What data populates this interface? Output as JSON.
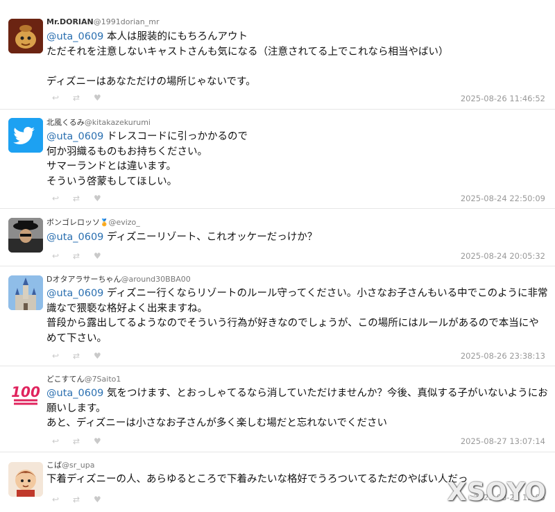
{
  "colors": {
    "mention": "#2a6fb0",
    "time": "#999999",
    "divider": "#e6e6e6"
  },
  "tweets": [
    {
      "name": "Mr.DORIAN",
      "handle": "@1991dorian_mr",
      "mention": "@uta_0609",
      "text": " 本人は服装的にもちろんアウト\nただそれを注意しないキャストさんも気になる（注意されてる上でこれなら相当やばい）\n\nディズニーはあなただけの場所じゃないです。",
      "time": "2025-08-26 11:46:52",
      "avatar_icon": "mrs-potts-icon"
    },
    {
      "name": "北風くるみ",
      "handle": "@kitakazekurumi",
      "mention": "@uta_0609",
      "text": " ドレスコードに引っかかるので\n何か羽織るものもお持ちください。\nサマーランドとは違います。\nそういう啓蒙もしてほしい。",
      "time": "2025-08-24 22:50:09",
      "avatar_icon": "twitter-bird-icon"
    },
    {
      "name": "ボンゴレロッソ",
      "badge": "🏅",
      "handle": "@evizo_",
      "mention": "@uta_0609",
      "text": " ディズニーリゾート、これオッケーだっけか？",
      "time": "2025-08-24 20:05:32",
      "avatar_icon": "person-hat-icon"
    },
    {
      "name": "Dオタアラサーちゃん",
      "handle": "@around30BBA00",
      "mention": "@uta_0609",
      "text": " ディズニー行くならリゾートのルール守ってください。小さなお子さんもいる中でこのように非常識なで猥褻な格好よく出来ますね。\n普段から露出してるようなのでそういう行為が好きなのでしょうが、この場所にはルールがあるので本当にやめて下さい。",
      "time": "2025-08-26 23:38:13",
      "avatar_icon": "castle-icon"
    },
    {
      "name": "どこすてん",
      "handle": "@7Saito1",
      "mention": "@uta_0609",
      "text": " 気をつけます、とおっしゃてるなら消していただけませんか？今後、真似する子がいないようにお願いします。\nあと、ディズニーは小さなお子さんが多く楽しむ場だと忘れないでください",
      "time": "2025-08-27 13:07:14",
      "avatar_icon": "hundred-points-icon"
    },
    {
      "name": "こば",
      "handle": "@sr_upa",
      "mention": "",
      "text": "下着ディズニーの人、あらゆるところで下着みたいな格好でうろついてるただのやばい人だっ",
      "time": "2025-08-27 12:05",
      "avatar_icon": "cartoon-boy-icon"
    }
  ],
  "watermark": "XSOYO"
}
